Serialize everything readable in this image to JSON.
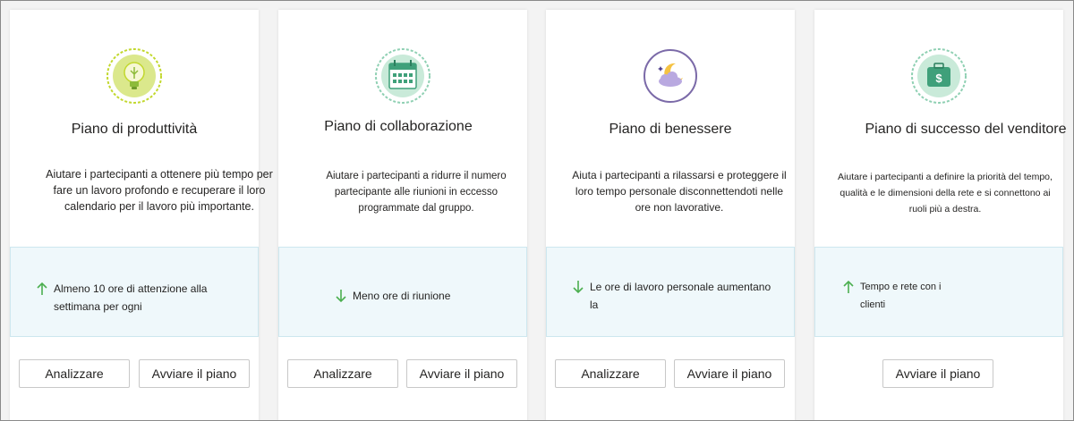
{
  "cards": [
    {
      "title": "Piano di produttività",
      "description": "Aiutare i partecipanti a ottenere più tempo per fare un lavoro profondo e recuperare il loro calendario per il lavoro più importante.",
      "metric": "Almeno 10 ore di attenzione alla settimana per ogni",
      "metric_direction": "up",
      "icon": "lightbulb-icon",
      "analyze_label": "Analizzare",
      "start_label": "Avviare il piano"
    },
    {
      "title": "Piano di collaborazione",
      "description": "Aiutare i partecipanti a ridurre il numero partecipante alle riunioni in eccesso programmate dal gruppo.",
      "metric": "Meno ore di riunione",
      "metric_direction": "down",
      "icon": "calendar-icon",
      "analyze_label": "Analizzare",
      "start_label": "Avviare il piano"
    },
    {
      "title": "Piano di benessere",
      "description": "Aiuta i partecipanti a rilassarsi e proteggere il loro tempo personale disconnettendoti nelle ore non lavorative.",
      "metric": "Le ore di lavoro personale aumentano la",
      "metric_direction": "down",
      "icon": "moon-cloud-icon",
      "analyze_label": "Analizzare",
      "start_label": "Avviare il piano"
    },
    {
      "title": "Piano di successo del venditore",
      "description": "Aiutare i partecipanti a definire la priorità del tempo, qualità e le dimensioni della rete e si connettono ai ruoli più a destra.",
      "metric": "Tempo e rete con i clienti",
      "metric_direction": "up",
      "icon": "money-bag-icon",
      "start_label": "Avviare il piano"
    }
  ],
  "colors": {
    "up_arrow": "#4caf50",
    "down_arrow": "#4caf50",
    "metric_bg": "#eff8fb",
    "lightbulb": "#c2d82e",
    "calendar": "#3fa07a",
    "moon": "#7b6aa8",
    "money": "#3fa07a"
  }
}
